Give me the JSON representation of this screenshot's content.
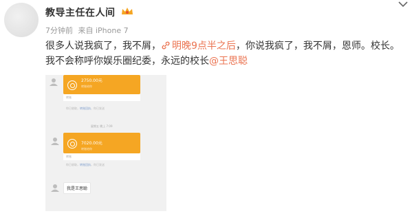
{
  "post": {
    "username": "教导主任在人间",
    "time": "7分钟前",
    "source": "来自 iPhone 7",
    "text_part1": "很多人说我疯了，我不屑，",
    "link_text": "明晚9点半之后",
    "text_part2": "，你说我疯了，我不屑，恩师。校长。我不会称呼你娱乐圈纪委，永远的校长",
    "mention": "@王思聪"
  },
  "chat": {
    "transfer1": {
      "amount": "2750.00元",
      "note": "转账给你",
      "footer": "转账"
    },
    "system1": {
      "prefix": "你已收取，",
      "link": "转账回执",
      "suffix": "，你已发送"
    },
    "time_label": "星期五 晚上 7:09",
    "transfer2": {
      "amount": "7020.00元",
      "note": "转账给你",
      "footer": "转账"
    },
    "system2": {
      "prefix": "你已收取，",
      "link": "转账回执",
      "suffix": "，你已发送"
    },
    "message": "我是王思聪"
  },
  "colors": {
    "link": "#eb7350",
    "transfer": "#f5a623",
    "chat_bg": "#f1f1f1"
  }
}
